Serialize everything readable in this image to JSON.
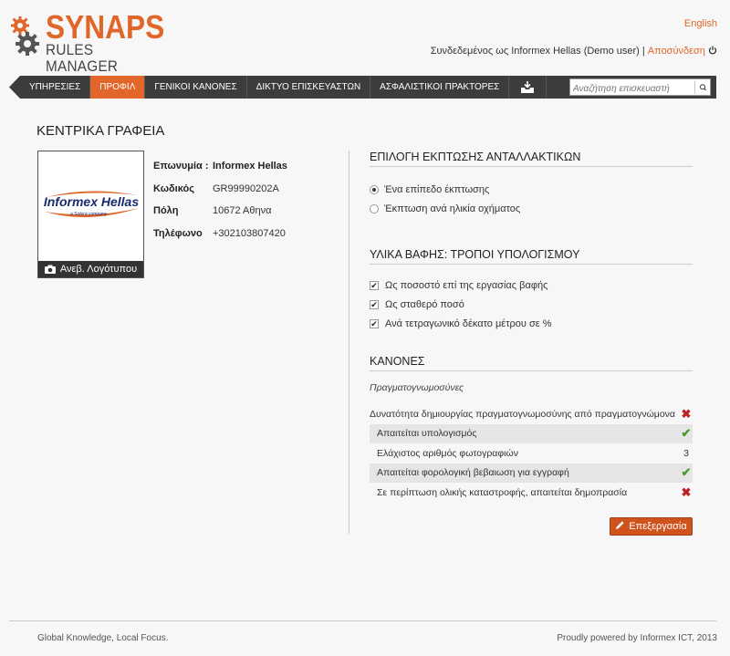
{
  "header": {
    "brand": "SYNAPS",
    "brand_sub": "RULES MANAGER",
    "language": "English",
    "logged_in_text": "Συνδεδεμένος ως Informex Hellas (Demo user) |",
    "logout": "Αποσύνδεση"
  },
  "nav": {
    "items": [
      "ΥΠΗΡΕΣΙΕΣ",
      "ΠΡΟΦΙΛ",
      "ΓΕΝΙΚΟΙ ΚΑΝΟΝΕΣ",
      "ΔΙΚΤΥΟ ΕΠΙΣΚΕΥΑΣΤΩΝ",
      "ΑΣΦΑΛΙΣΤΙΚΟΙ ΠΡΑΚΤΟΡΕΣ"
    ],
    "active": "ΠΡΟΦΙΛ",
    "search_placeholder": "Αναζήτηση επισκευαστή"
  },
  "page": {
    "title": "ΚΕΝΤΡΙΚΑ ΓΡΑΦΕΙΑ"
  },
  "profile": {
    "logo_text": "Informex Hellas",
    "logo_tagline": "a Solera company",
    "upload_label": "Ανεβ. Λογότυπου",
    "fields": [
      {
        "label": "Επωνυμία :",
        "value": "Informex Hellas"
      },
      {
        "label": "Κωδικός",
        "value": "GR99990202A"
      },
      {
        "label": "Πόλη",
        "value": "10672 Αθηνα"
      },
      {
        "label": "Τηλέφωνο",
        "value": "+302103807420"
      }
    ]
  },
  "discount": {
    "title": "ΕΠΙΛΟΓΗ ΕΚΠΤΩΣΗΣ ΑΝΤΑΛΛΑΚΤΙΚΩΝ",
    "options": [
      "Ένα επίπεδο έκπτωσης",
      "Έκπτωση ανά ηλικία οχήματος"
    ],
    "selected": 0
  },
  "paint": {
    "title": "ΥΛΙΚΑ ΒΑΦΗΣ: ΤΡΟΠΟΙ ΥΠΟΛΟΓΙΣΜΟΥ",
    "options": [
      "Ως ποσοστό επί της εργασίας βαφής",
      "Ως σταθερό ποσό",
      "Ανά τετραγωνικό δέκατο μέτρου σε %"
    ]
  },
  "rules": {
    "title": "ΚΑΝΟΝΕΣ",
    "subtitle": "Πραγματογνωμοσύνες",
    "rows": [
      {
        "text": "Δυνατότητα δημιουργίας πραγματογνωμοσύνης από πραγματογνώμονα",
        "status": "✖"
      },
      {
        "text": "Απαιτείται υπολογισμός",
        "status": "✔"
      },
      {
        "text": "Ελάχιστος αριθμός φωτογραφιών",
        "status": "3"
      },
      {
        "text": "Απαιτείται φορολογική βεβαιωση για εγγραφή",
        "status": "✔"
      },
      {
        "text": "Σε περίπτωση ολικής καταστροφής, απαιτείται δημοπρασία",
        "status": "✖"
      }
    ],
    "edit_label": "Επεξεργασία"
  },
  "footer": {
    "left": "Global Knowledge, Local Focus.",
    "right": "Proudly powered by Informex ICT, 2013"
  },
  "colors": {
    "accent": "#e0662a",
    "nav_bg": "#3c3c3c",
    "ok": "#4a9a2a",
    "no": "#b22222"
  }
}
